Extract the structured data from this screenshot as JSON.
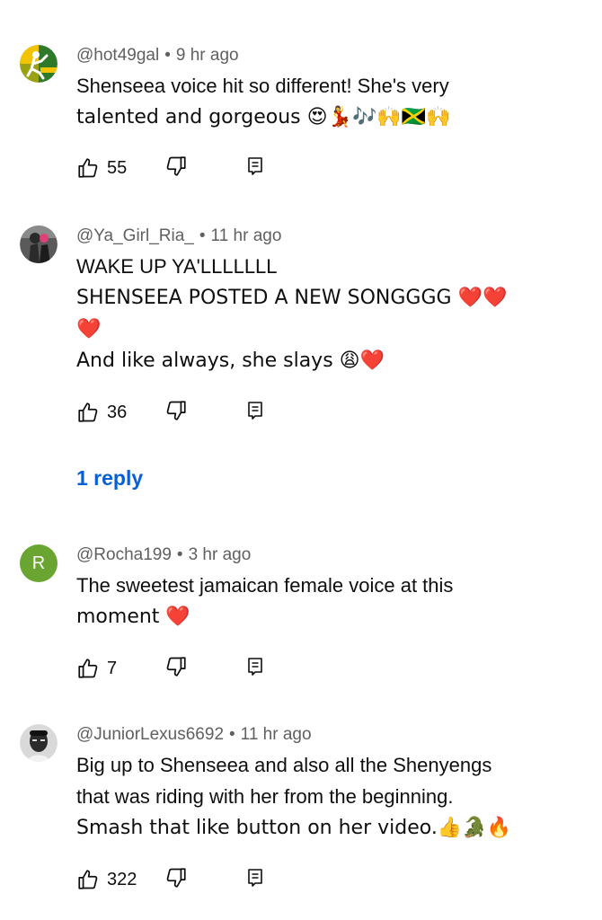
{
  "comments": [
    {
      "handle": "@hot49gal",
      "time": "9 hr ago",
      "avatar_text": "DANCE",
      "avatar_colors": {
        "bg": "#2f7a2a",
        "accent": "#f2c300"
      },
      "lines": [
        "Shenseea voice hit so different! She's very",
        "talented and gorgeous 😍💃🎶🙌🇯🇲🙌"
      ],
      "likes": "55"
    },
    {
      "handle": "@Ya_Girl_Ria_",
      "time": "11 hr ago",
      "avatar_colors": {
        "bg": "#3a3a3a",
        "accent": "#e0407a"
      },
      "lines": [
        "WAKE UP YA'LLLLLLL",
        "SHENSEEA POSTED A NEW SONGGGG ❤️❤️",
        "❤️",
        "And like always, she slays 😩❤️"
      ],
      "likes": "36",
      "reply_link": "1 reply"
    },
    {
      "handle": "@Rocha199",
      "time": "3 hr ago",
      "avatar_letter": "R",
      "avatar_colors": {
        "bg": "#6aa532",
        "accent": "#ffffff"
      },
      "lines": [
        "The sweetest jamaican female voice at this",
        "moment ❤️"
      ],
      "likes": "7"
    },
    {
      "handle": "@JuniorLexus6692",
      "time": "11 hr ago",
      "avatar_colors": {
        "bg": "#d9d9d9",
        "accent": "#2b2b2b"
      },
      "lines": [
        "Big up to Shenseea and also all the Shenyengs",
        "that was riding with her from the beginning.",
        "Smash that like button on her video.👍🐊🔥"
      ],
      "likes": "322"
    }
  ],
  "colors": {
    "meta": "#606060",
    "text": "#0f0f0f",
    "link": "#065fd4"
  },
  "icons": {
    "like": "thumbs-up-icon",
    "dislike": "thumbs-down-icon",
    "reply": "reply-icon"
  }
}
